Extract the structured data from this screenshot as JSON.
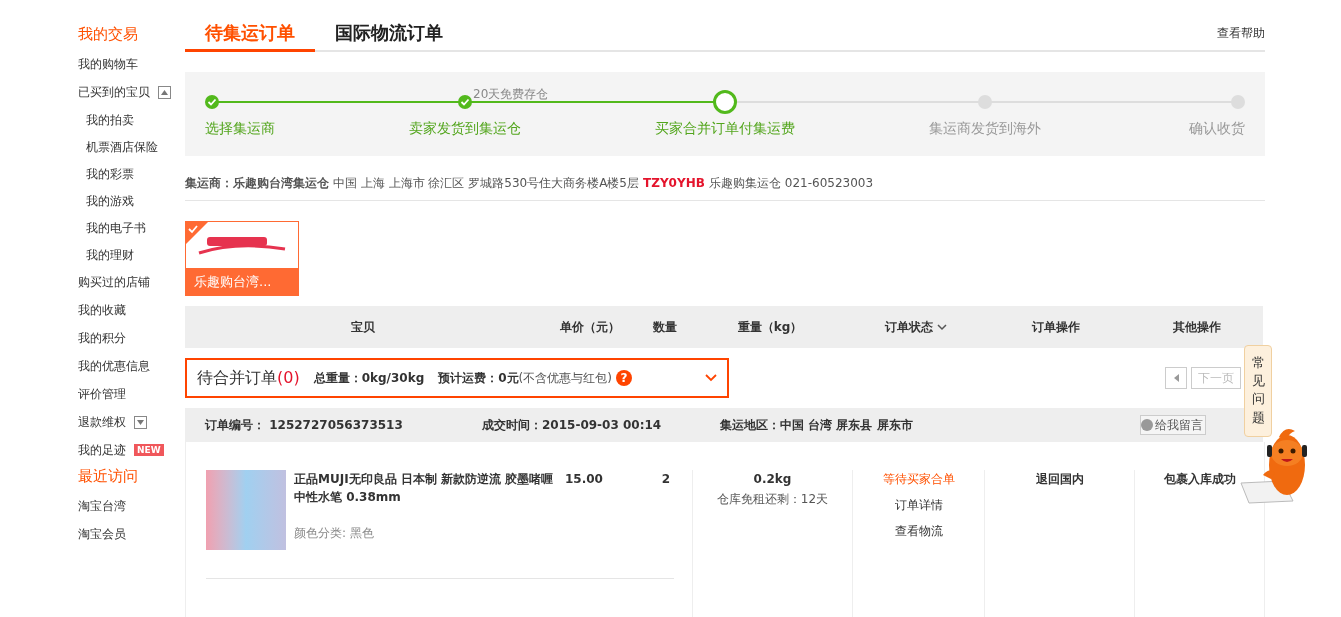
{
  "sidebar": {
    "sections": [
      {
        "title": "我的交易",
        "items": [
          {
            "label": "我的购物车"
          },
          {
            "label": "已买到的宝贝",
            "expanded": true,
            "children": [
              {
                "label": "我的拍卖"
              },
              {
                "label": "机票酒店保险"
              },
              {
                "label": "我的彩票"
              },
              {
                "label": "我的游戏"
              },
              {
                "label": "我的电子书"
              },
              {
                "label": "我的理财"
              }
            ]
          },
          {
            "label": "购买过的店铺"
          },
          {
            "label": "我的收藏"
          },
          {
            "label": "我的积分"
          },
          {
            "label": "我的优惠信息"
          },
          {
            "label": "评价管理"
          },
          {
            "label": "退款维权",
            "expanded": false
          },
          {
            "label": "我的足迹",
            "badge": "NEW"
          }
        ]
      },
      {
        "title": "最近访问",
        "items": [
          {
            "label": "淘宝台湾"
          },
          {
            "label": "淘宝会员"
          }
        ]
      }
    ]
  },
  "tabs": [
    {
      "label": "待集运订单",
      "selected": true
    },
    {
      "label": "国际物流订单",
      "selected": false
    }
  ],
  "help_link": "查看帮助",
  "progress": {
    "steps": [
      {
        "label": "选择集运商",
        "kind": "done"
      },
      {
        "label": "卖家发货到集运仓",
        "kind": "done",
        "note": "20天免费存仓"
      },
      {
        "label": "买家合并订单付集运费",
        "kind": "current"
      },
      {
        "label": "集运商发货到海外",
        "kind": "todo"
      },
      {
        "label": "确认收货",
        "kind": "todo"
      }
    ]
  },
  "warehouse_info": {
    "label": "集运商：乐趣购台湾集运仓",
    "address": "中国 上海 上海市 徐汇区 罗城路530号住大商务楼A楼5层",
    "code": "TZY0YHB",
    "name": "乐趣购集运仓",
    "phone": "021-60523003"
  },
  "carriers": [
    {
      "name": "乐趣购台湾...",
      "selected": true
    }
  ],
  "table": {
    "columns": [
      {
        "label": "宝贝"
      },
      {
        "label": "单价（元）"
      },
      {
        "label": "数量"
      },
      {
        "label": "重量（kg）"
      },
      {
        "label": "订单状态",
        "dropdown": true
      },
      {
        "label": "订单操作"
      },
      {
        "label": "其他操作"
      }
    ]
  },
  "merge_bar": {
    "title": "待合并订单",
    "count": "(0)",
    "total_weight": "总重量：0kg/30kg",
    "estimated_fee": "预计运费：0元",
    "fee_note": "(不含优惠与红包)",
    "help": "?"
  },
  "pager": {
    "next": "下一页"
  },
  "order": {
    "number_label": "订单编号：",
    "number": "1252727056373513",
    "time_label": "成交时间：",
    "time": "2015-09-03 00:14",
    "region_label": "集运地区：",
    "region": "中国 台湾 屏东县 屏东市",
    "message_button": "给我留言",
    "items": [
      {
        "title": "正品MUJI无印良品 日本制 新款防逆流 胶墨啫喱中性水笔 0.38mm",
        "spec": "颜色分类: 黑色",
        "price": "15.00",
        "quantity": "2"
      }
    ],
    "weight": "0.2kg",
    "storage": "仓库免租还剩：12天",
    "status": "等待买家合单",
    "actions": [
      "订单详情",
      "查看物流"
    ],
    "order_operation": "退回国内",
    "other_operation": "包裹入库成功"
  },
  "faq_tab": "常见问题"
}
